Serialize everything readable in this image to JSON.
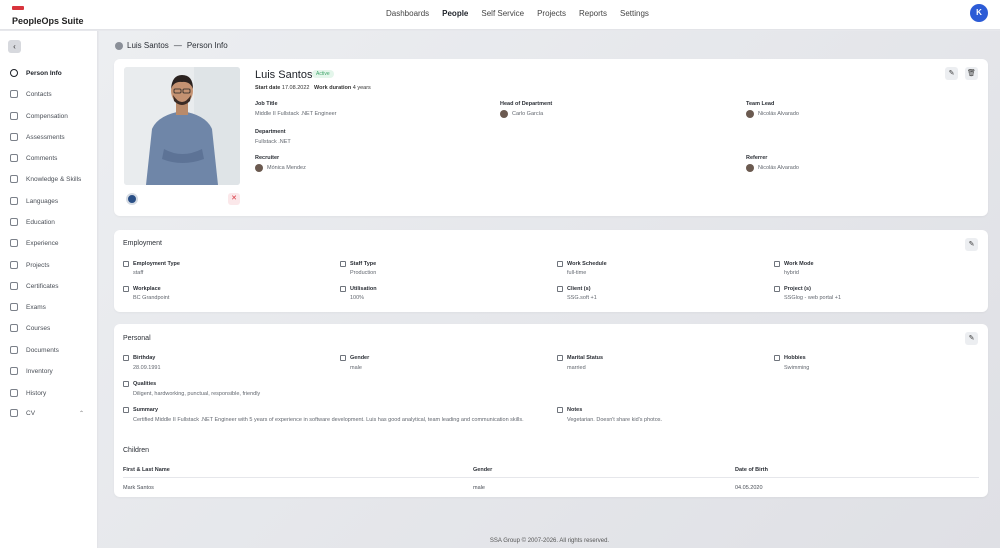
{
  "app": {
    "name": "PeopleOps Suite",
    "user_initial": "K"
  },
  "nav": [
    "Dashboards",
    "People",
    "Self Service",
    "Projects",
    "Reports",
    "Settings"
  ],
  "sidebar": [
    "Person Info",
    "Contacts",
    "Compensation",
    "Assessments",
    "Comments",
    "Knowledge & Skills",
    "Languages",
    "Education",
    "Experience",
    "Projects",
    "Certificates",
    "Exams",
    "Courses",
    "Documents",
    "Inventory",
    "History",
    "CV"
  ],
  "breadcrumb": {
    "person": "Luis Santos",
    "sep": "—",
    "page": "Person Info"
  },
  "profile": {
    "name": "Luis Santos",
    "status": "Active",
    "start_label": "Start date",
    "start_date": "17.08.2022",
    "duration_label": "Work duration",
    "duration": "4 years",
    "job_title_label": "Job Title",
    "job_title": "Middle II Fullstack .NET Engineer",
    "hod_label": "Head of Department",
    "hod": "Carlo García",
    "team_lead_label": "Team Lead",
    "team_lead": "Nicolás Alvarado",
    "department_label": "Department",
    "department": "Fullstack .NET",
    "recruiter_label": "Recruiter",
    "recruiter": "Mónica Mendez",
    "referrer_label": "Referrer",
    "referrer": "Nicolás Alvarado"
  },
  "employment": {
    "title": "Employment",
    "fields": [
      {
        "label": "Employment Type",
        "value": "staff"
      },
      {
        "label": "Staff Type",
        "value": "Production"
      },
      {
        "label": "Work Schedule",
        "value": "full-time"
      },
      {
        "label": "Work Mode",
        "value": "hybrid"
      },
      {
        "label": "Workplace",
        "value": "BC Grandpoint"
      },
      {
        "label": "Utilisation",
        "value": "100%"
      },
      {
        "label": "Client (s)",
        "value": "SSG.soft +1"
      },
      {
        "label": "Project (s)",
        "value": "SSGlog - web portal +1"
      }
    ]
  },
  "personal": {
    "title": "Personal",
    "birthday_label": "Birthday",
    "birthday": "28.09.1991",
    "gender_label": "Gender",
    "gender": "male",
    "marital_label": "Marital Status",
    "marital": "married",
    "hobbies_label": "Hobbies",
    "hobbies": "Swimming",
    "qualities_label": "Qualities",
    "qualities": "Diligent, hardworking, punctual, responsible, friendly",
    "summary_label": "Summary",
    "summary": "Certified Middle II Fullstack .NET Engineer with 5 years of experience in software development. Luis has good analytical, team leading and communication skills.",
    "notes_label": "Notes",
    "notes": "Vegetarian. Doesn't share kid's photos."
  },
  "children": {
    "title": "Children",
    "headers": [
      "First & Last Name",
      "Gender",
      "Date of Birth"
    ],
    "rows": [
      [
        "Mark Santos",
        "male",
        "04.05.2020"
      ]
    ]
  },
  "footer": "SSA Group © 2007-2026. All rights reserved."
}
